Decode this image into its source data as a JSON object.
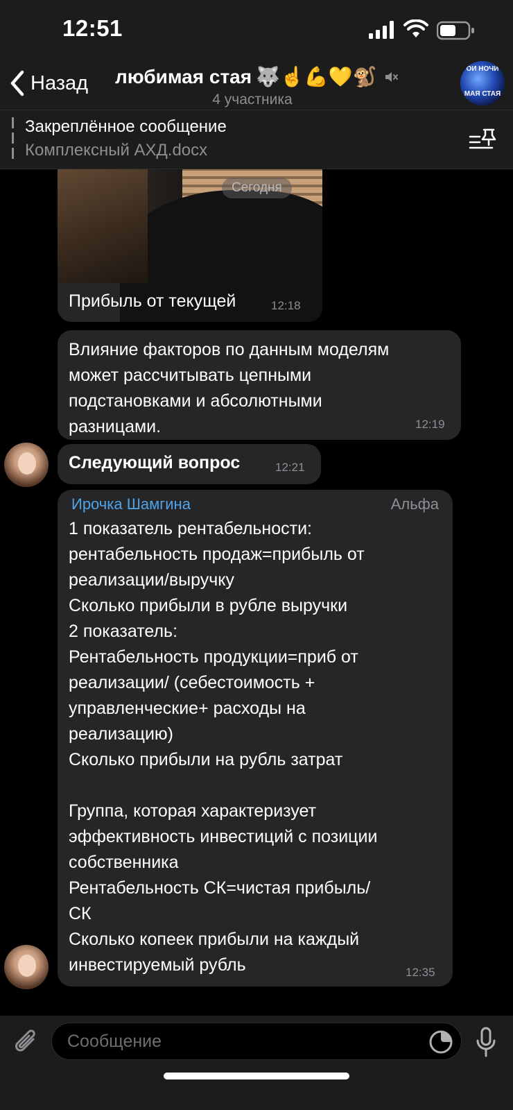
{
  "status_bar": {
    "time": "12:51"
  },
  "nav": {
    "back_label": "Назад",
    "title": "любимая стая",
    "title_emojis": "🐺☝️💪💛🐒",
    "subtitle": "4 участника",
    "avatar_text_top": "ОИ НОЧИ",
    "avatar_text_bottom": "МАЯ СТАЯ"
  },
  "pinned": {
    "title": "Закреплённое сообщение",
    "text": "Комплексный АХД.docx"
  },
  "date_separator": "Сегодня",
  "messages": [
    {
      "text": "Прибыль от текущей",
      "time": "12:18"
    },
    {
      "text": "Влияние факторов по данным моделям\nможет рассчитывать цепными\nподстановками и абсолютными\nразницами.",
      "time": "12:19"
    },
    {
      "text": "Следующий вопрос",
      "time": "12:21"
    },
    {
      "sender": "Ирочка Шамгина",
      "sender_tag": "Альфа",
      "sender_color": "#4fa3e8",
      "text": "1 показатель рентабельности:\nрентабельность продаж=прибыль от\nреализации/выручку\nСколько прибыли в рубле выручки\n2 показатель:\nРентабельность продукции=приб от\nреализации/ (себестоимость +\nуправленческие+ расходы на\nреализацию)\nСколько прибыли на рубль затрат\n\nГруппа, которая характеризует\nэффективность инвестиций с позиции\nсобственника\nРентабельность СК=чистая прибыль/\nСК\nСколько копеек прибыли на каждый\nинвестируемый рубль",
      "time": "12:35"
    }
  ],
  "input": {
    "placeholder": "Сообщение"
  }
}
